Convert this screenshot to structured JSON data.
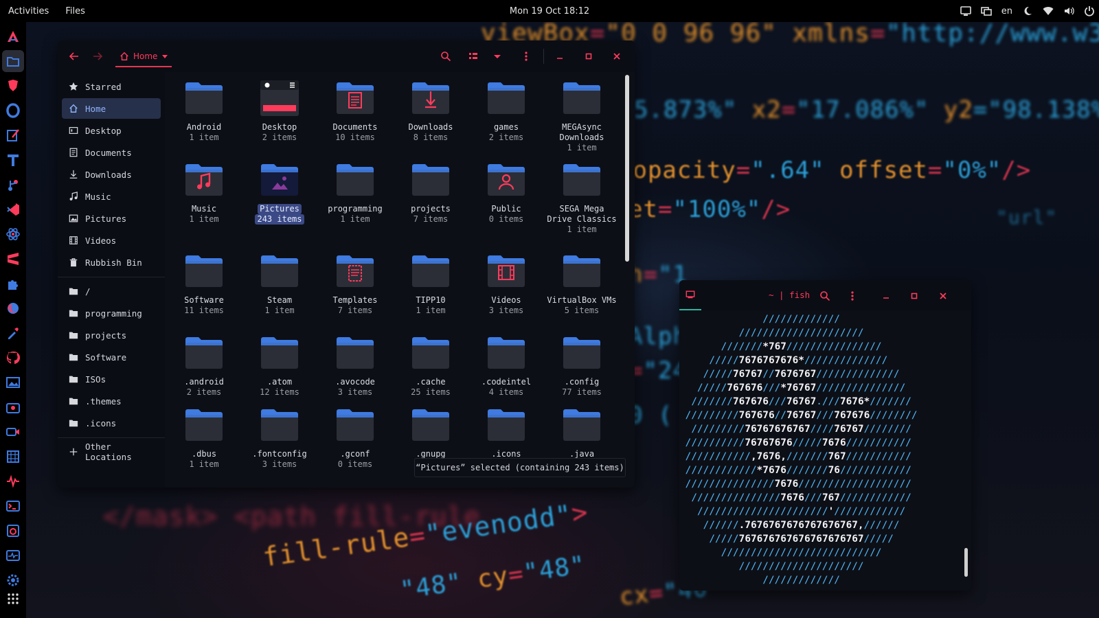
{
  "topbar": {
    "activities": "Activities",
    "app": "Files",
    "clock": "Mon 19 Oct 18:12",
    "lang": "en"
  },
  "files": {
    "path_label": "Home",
    "sidebar": {
      "starred": "Starred",
      "home": "Home",
      "desktop": "Desktop",
      "documents": "Documents",
      "downloads": "Downloads",
      "music": "Music",
      "pictures": "Pictures",
      "videos": "Videos",
      "rubbish": "Rubbish Bin",
      "root": "/",
      "programming": "programming",
      "projects": "projects",
      "software": "Software",
      "isos": "ISOs",
      "themes": ".themes",
      "icons": ".icons",
      "other": "Other Locations"
    },
    "folders": [
      {
        "name": "Android",
        "count": "1 item",
        "icon": "plain"
      },
      {
        "name": "Desktop",
        "count": "2 items",
        "icon": "desktop"
      },
      {
        "name": "Documents",
        "count": "10 items",
        "icon": "documents"
      },
      {
        "name": "Downloads",
        "count": "8 items",
        "icon": "downloads"
      },
      {
        "name": "games",
        "count": "2 items",
        "icon": "plain"
      },
      {
        "name": "MEGAsync Downloads",
        "count": "1 item",
        "icon": "plain"
      },
      {
        "name": "Music",
        "count": "1 item",
        "icon": "music"
      },
      {
        "name": "Pictures",
        "count": "243 items",
        "icon": "pictures"
      },
      {
        "name": "programming",
        "count": "1 item",
        "icon": "plain"
      },
      {
        "name": "projects",
        "count": "7 items",
        "icon": "plain"
      },
      {
        "name": "Public",
        "count": "0 items",
        "icon": "public"
      },
      {
        "name": "SEGA Mega Drive Classics",
        "count": "1 item",
        "icon": "plain"
      },
      {
        "name": "Software",
        "count": "11 items",
        "icon": "plain"
      },
      {
        "name": "Steam",
        "count": "1 item",
        "icon": "plain"
      },
      {
        "name": "Templates",
        "count": "7 items",
        "icon": "templates"
      },
      {
        "name": "TIPP10",
        "count": "1 item",
        "icon": "plain"
      },
      {
        "name": "Videos",
        "count": "3 items",
        "icon": "videos"
      },
      {
        "name": "VirtualBox VMs",
        "count": "5 items",
        "icon": "plain"
      },
      {
        "name": ".android",
        "count": "2 items",
        "icon": "plain"
      },
      {
        "name": ".atom",
        "count": "12 items",
        "icon": "plain"
      },
      {
        "name": ".avocode",
        "count": "3 items",
        "icon": "plain"
      },
      {
        "name": ".cache",
        "count": "25 items",
        "icon": "plain"
      },
      {
        "name": ".codeintel",
        "count": "4 items",
        "icon": "plain"
      },
      {
        "name": ".config",
        "count": "77 items",
        "icon": "plain"
      },
      {
        "name": ".dbus",
        "count": "1 item",
        "icon": "plain"
      },
      {
        "name": ".fontconfig",
        "count": "3 items",
        "icon": "plain"
      },
      {
        "name": ".gconf",
        "count": "0 items",
        "icon": "plain"
      },
      {
        "name": ".gnupg",
        "count": "",
        "icon": "plain"
      },
      {
        "name": ".icons",
        "count": "",
        "icon": "plain"
      },
      {
        "name": ".java",
        "count": "",
        "icon": "plain"
      }
    ],
    "selected_folder": "Pictures",
    "status": "“Pictures” selected (containing 243 items)"
  },
  "terminal": {
    "title": "~ | fish",
    "lines": [
      [
        [
          "b",
          "/////////////"
        ]
      ],
      [
        [
          "b",
          "/////////////////////"
        ]
      ],
      [
        [
          "b",
          "///////"
        ],
        [
          "w",
          "*767"
        ],
        [
          "b",
          "////////////////"
        ]
      ],
      [
        [
          "b",
          "/////"
        ],
        [
          "w",
          "7676767676*"
        ],
        [
          "b",
          "//////////////"
        ]
      ],
      [
        [
          "b",
          "/////"
        ],
        [
          "w",
          "76767"
        ],
        [
          "b",
          "//"
        ],
        [
          "w",
          "7676767"
        ],
        [
          "b",
          "//////////////"
        ]
      ],
      [
        [
          "b",
          "/////"
        ],
        [
          "w",
          "767676"
        ],
        [
          "b",
          "///"
        ],
        [
          "w",
          "*76767"
        ],
        [
          "b",
          "///////////////"
        ]
      ],
      [
        [
          "b",
          "///////"
        ],
        [
          "w",
          "767676"
        ],
        [
          "b",
          "///"
        ],
        [
          "w",
          "76767"
        ],
        [
          "b",
          ".///"
        ],
        [
          "w",
          "7676*"
        ],
        [
          "b",
          "///////"
        ]
      ],
      [
        [
          "b",
          "/////////"
        ],
        [
          "w",
          "767676"
        ],
        [
          "b",
          "//"
        ],
        [
          "w",
          "76767"
        ],
        [
          "b",
          "///"
        ],
        [
          "w",
          "767676"
        ],
        [
          "b",
          "////////"
        ]
      ],
      [
        [
          "b",
          "/////////"
        ],
        [
          "w",
          "76767676767"
        ],
        [
          "b",
          "////"
        ],
        [
          "w",
          "76767"
        ],
        [
          "b",
          "////////"
        ]
      ],
      [
        [
          "b",
          "//////////"
        ],
        [
          "w",
          "76767676"
        ],
        [
          "b",
          "/////"
        ],
        [
          "w",
          "7676"
        ],
        [
          "b",
          "///////////"
        ]
      ],
      [
        [
          "b",
          "///////////"
        ],
        [
          "w",
          ",7676,"
        ],
        [
          "b",
          "///////"
        ],
        [
          "w",
          "767"
        ],
        [
          "b",
          "///////////"
        ]
      ],
      [
        [
          "b",
          "////////////"
        ],
        [
          "w",
          "*7676"
        ],
        [
          "b",
          "///////"
        ],
        [
          "w",
          "76"
        ],
        [
          "b",
          "////////////"
        ]
      ],
      [
        [
          "b",
          "///////////////"
        ],
        [
          "w",
          "7676"
        ],
        [
          "b",
          "///////////////////"
        ]
      ],
      [
        [
          "b",
          "///////////////"
        ],
        [
          "w",
          "7676"
        ],
        [
          "b",
          "///"
        ],
        [
          "w",
          "767"
        ],
        [
          "b",
          "////////////"
        ]
      ],
      [
        [
          "b",
          "//////////////////////"
        ],
        [
          "w",
          "'"
        ],
        [
          "b",
          "////////////"
        ]
      ],
      [
        [
          "b",
          "//////"
        ],
        [
          "w",
          ".7676767676767676767,"
        ],
        [
          "b",
          "//////"
        ]
      ],
      [
        [
          "b",
          "/////"
        ],
        [
          "w",
          "767676767676767676767"
        ],
        [
          "b",
          "/////"
        ]
      ],
      [
        [
          "b",
          "///////////////////////////"
        ]
      ],
      [
        [
          "b",
          "/////////////////////"
        ]
      ],
      [
        [
          "b",
          "/////////////"
        ]
      ]
    ]
  },
  "colors": {
    "accent": "#ff3b5c",
    "folder_blue": "#3f7be0",
    "terminal_text": "#4fb6f5",
    "selection": "#3b4a86"
  }
}
